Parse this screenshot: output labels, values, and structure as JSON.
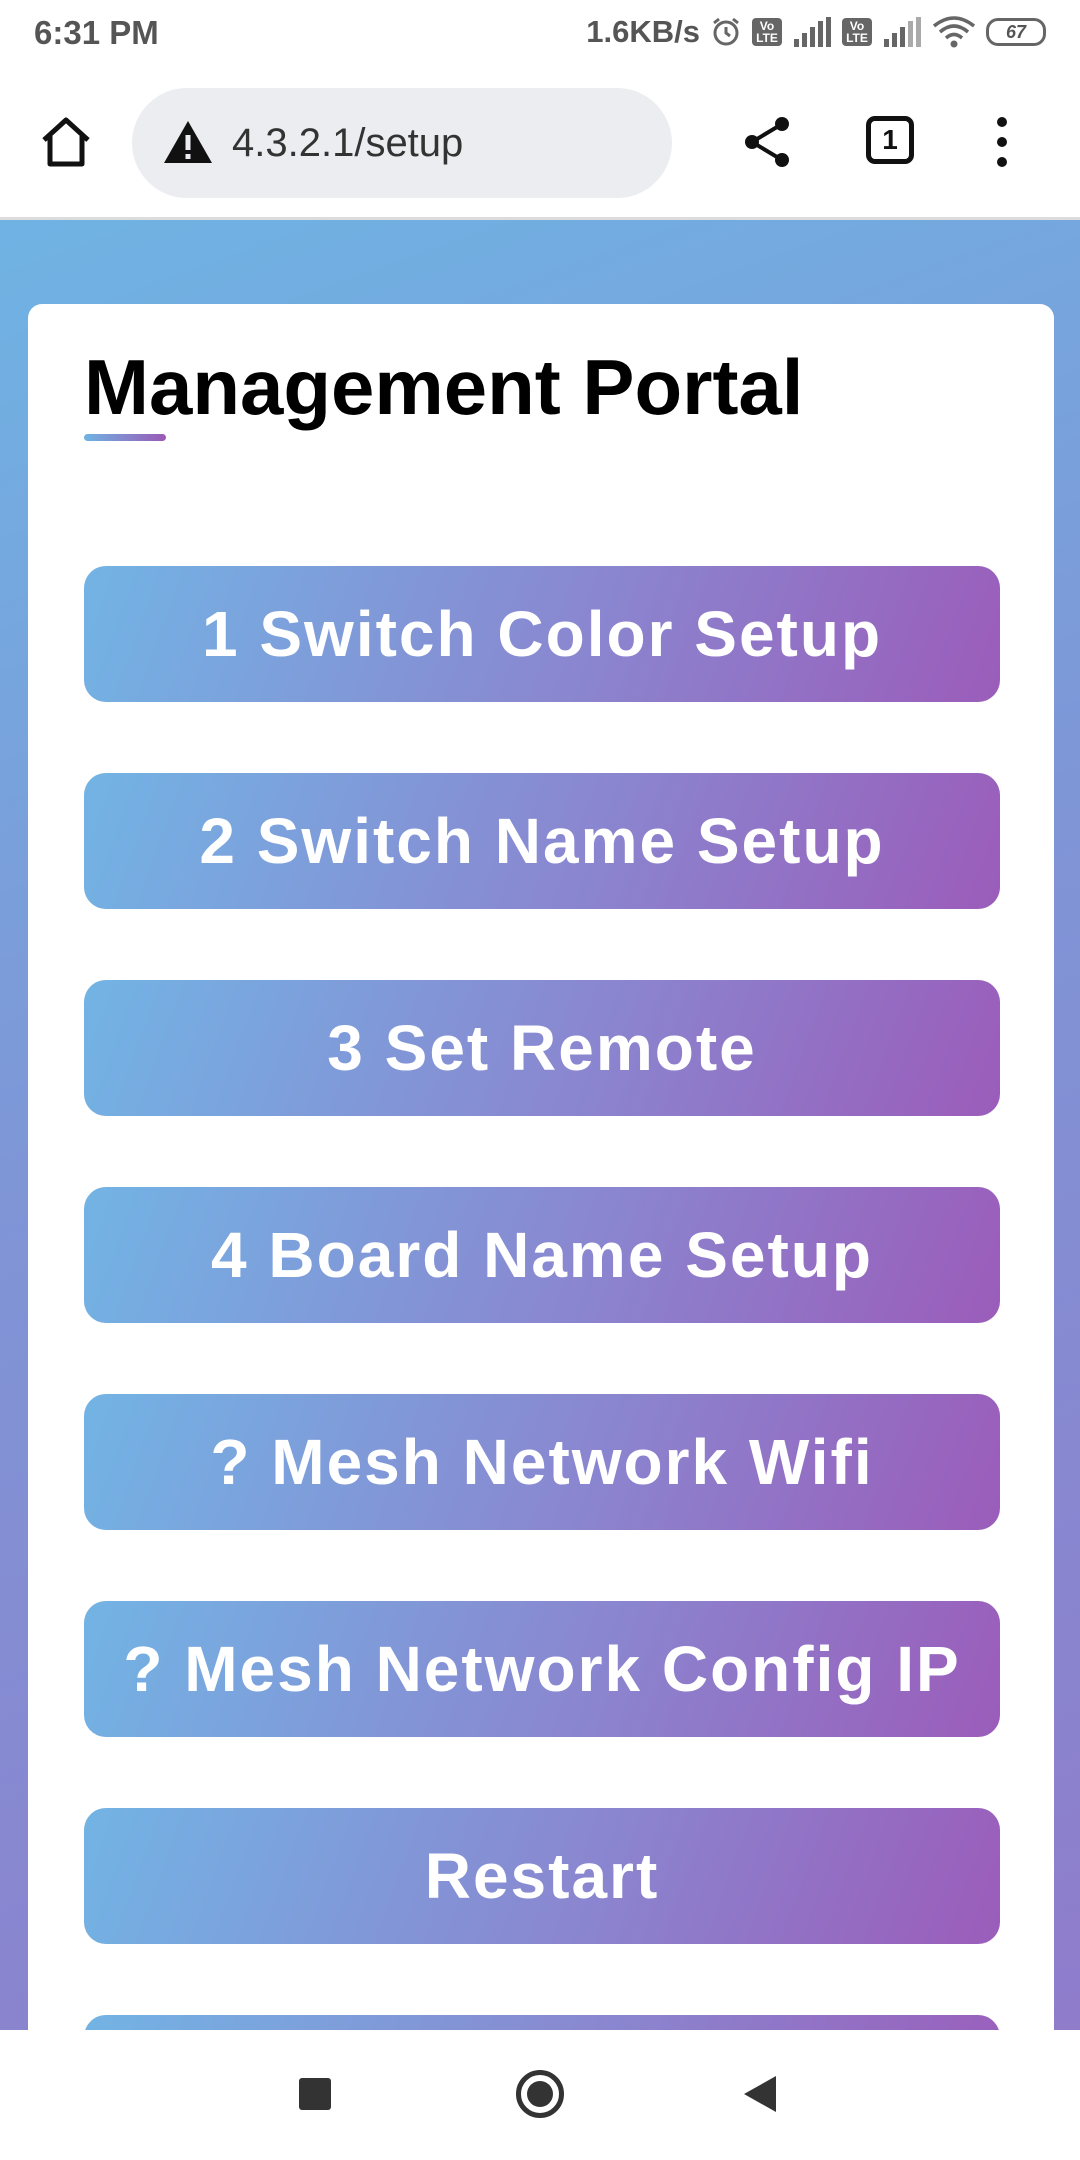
{
  "status_bar": {
    "time": "6:31 PM",
    "net_speed": "1.6KB/s",
    "volte_label": "Vo LTE",
    "battery": "67",
    "icons": [
      "alarm-icon",
      "volte-icon",
      "signal-icon",
      "volte-icon",
      "signal-icon",
      "wifi-icon",
      "battery-icon"
    ]
  },
  "browser": {
    "url": "4.3.2.1/setup",
    "tab_count": "1",
    "icons": [
      "home-icon",
      "warning-icon",
      "share-icon",
      "tabs-icon",
      "more-vert-icon"
    ]
  },
  "page": {
    "title": "Management Portal",
    "buttons": [
      {
        "label": "1 Switch Color Setup"
      },
      {
        "label": "2 Switch Name Setup"
      },
      {
        "label": "3 Set Remote"
      },
      {
        "label": "4 Board Name Setup"
      },
      {
        "label": "? Mesh Network Wifi"
      },
      {
        "label": "? Mesh Network Config IP"
      },
      {
        "label": "Restart"
      },
      {
        "label": ""
      }
    ],
    "colors": {
      "gradient_start": "#72b4e4",
      "gradient_end": "#9b5cba",
      "background_start": "#6fb3e3",
      "background_end": "#8f7ccb"
    }
  },
  "nav_bar": {
    "icons": [
      "recents-icon",
      "home-circle-icon",
      "back-icon"
    ]
  }
}
